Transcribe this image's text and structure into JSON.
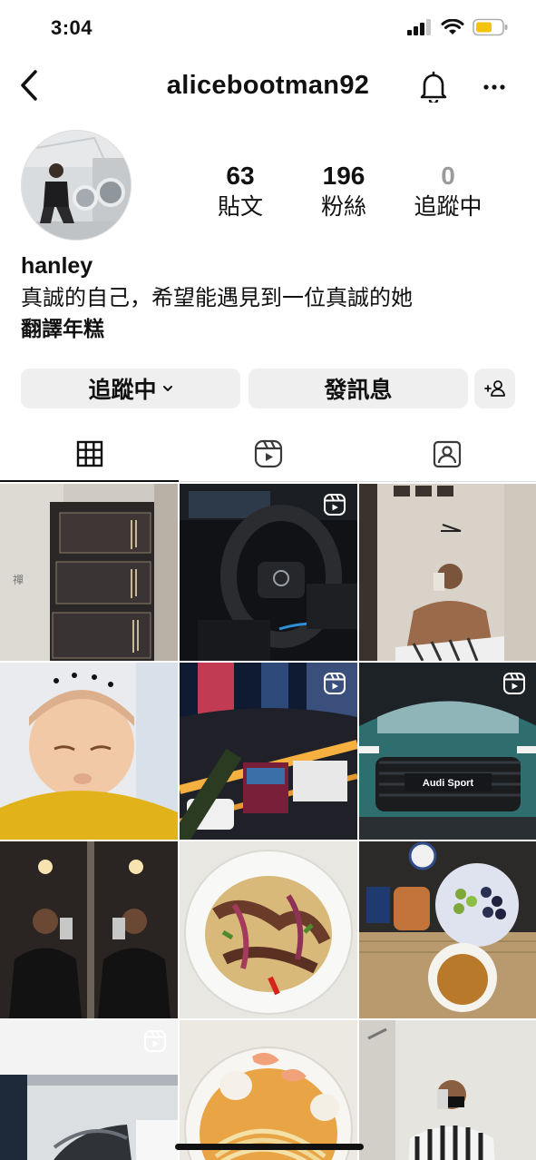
{
  "status_bar": {
    "time": "3:04",
    "battery_color": "#f2c40f"
  },
  "nav": {
    "username": "alicebootman92",
    "back_icon": "chevron-left-icon",
    "bell_icon": "bell-icon",
    "more_icon": "more-horizontal-icon"
  },
  "stats": [
    {
      "number": "63",
      "label": "貼文"
    },
    {
      "number": "196",
      "label": "粉絲"
    },
    {
      "number": "0",
      "label": "追蹤中"
    }
  ],
  "bio": {
    "name": "hanley",
    "text": "真誠的自己，希望能遇見到一位真誠的她",
    "translate": "翻譯年糕"
  },
  "buttons": {
    "following": "追蹤中",
    "message": "發訊息",
    "add_user_icon": "add-person-icon"
  },
  "tabs": [
    {
      "name": "grid",
      "icon": "grid-icon",
      "active": true
    },
    {
      "name": "reels",
      "icon": "reels-icon",
      "active": false
    },
    {
      "name": "tagged",
      "icon": "tagged-icon",
      "active": false
    }
  ],
  "posts": [
    {
      "subject": "tea-gift-box",
      "reel": false
    },
    {
      "subject": "car-steering-wheel",
      "reel": true
    },
    {
      "subject": "shirtless-mirror-selfie",
      "reel": false
    },
    {
      "subject": "baby-face",
      "reel": false
    },
    {
      "subject": "city-night-traffic",
      "reel": true
    },
    {
      "subject": "audi-sport-car",
      "reel": true
    },
    {
      "subject": "gym-mirror-selfie",
      "reel": false
    },
    {
      "subject": "beef-noodles",
      "reel": false
    },
    {
      "subject": "tea-and-fruit",
      "reel": false
    },
    {
      "subject": "garage-car",
      "reel": true
    },
    {
      "subject": "shrimp-noodle-soup",
      "reel": false
    },
    {
      "subject": "striped-shirt-selfie",
      "reel": false
    }
  ],
  "photo_text": {
    "audi_plate": "Audi Sport"
  }
}
